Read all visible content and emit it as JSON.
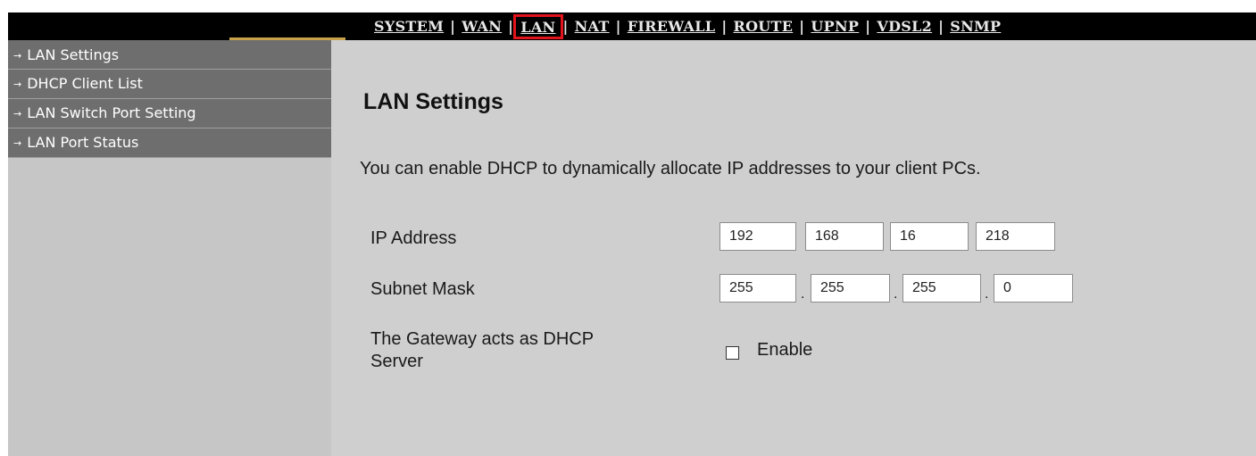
{
  "nav": {
    "items": [
      "SYSTEM",
      "WAN",
      "LAN",
      "NAT",
      "FIREWALL",
      "ROUTE",
      "UPNP",
      "VDSL2",
      "SNMP"
    ],
    "separator": "|",
    "active": "LAN"
  },
  "sidebar": {
    "items": [
      {
        "label": "LAN Settings"
      },
      {
        "label": "DHCP Client List"
      },
      {
        "label": "LAN Switch Port Setting"
      },
      {
        "label": "LAN Port Status"
      }
    ],
    "arrow": "→"
  },
  "main": {
    "title": "LAN Settings",
    "description": "You can enable DHCP to dynamically allocate IP addresses to your client PCs.",
    "ip_label": "IP Address",
    "ip": [
      "192",
      "168",
      "16",
      "218"
    ],
    "mask_label": "Subnet Mask",
    "mask": [
      "255",
      "255",
      "255",
      "0"
    ],
    "mask_separator": ".",
    "dhcp_label_line1": "The Gateway acts as DHCP",
    "dhcp_label_line2": "Server",
    "dhcp_option_label": "Enable",
    "dhcp_enabled": false
  },
  "colors": {
    "topbar": "#000000",
    "active_highlight": "#e2131a",
    "sidebar_item": "#6e6e6e",
    "sidebar_bg": "#c6c6c6",
    "main_bg": "#cfcfcf"
  }
}
